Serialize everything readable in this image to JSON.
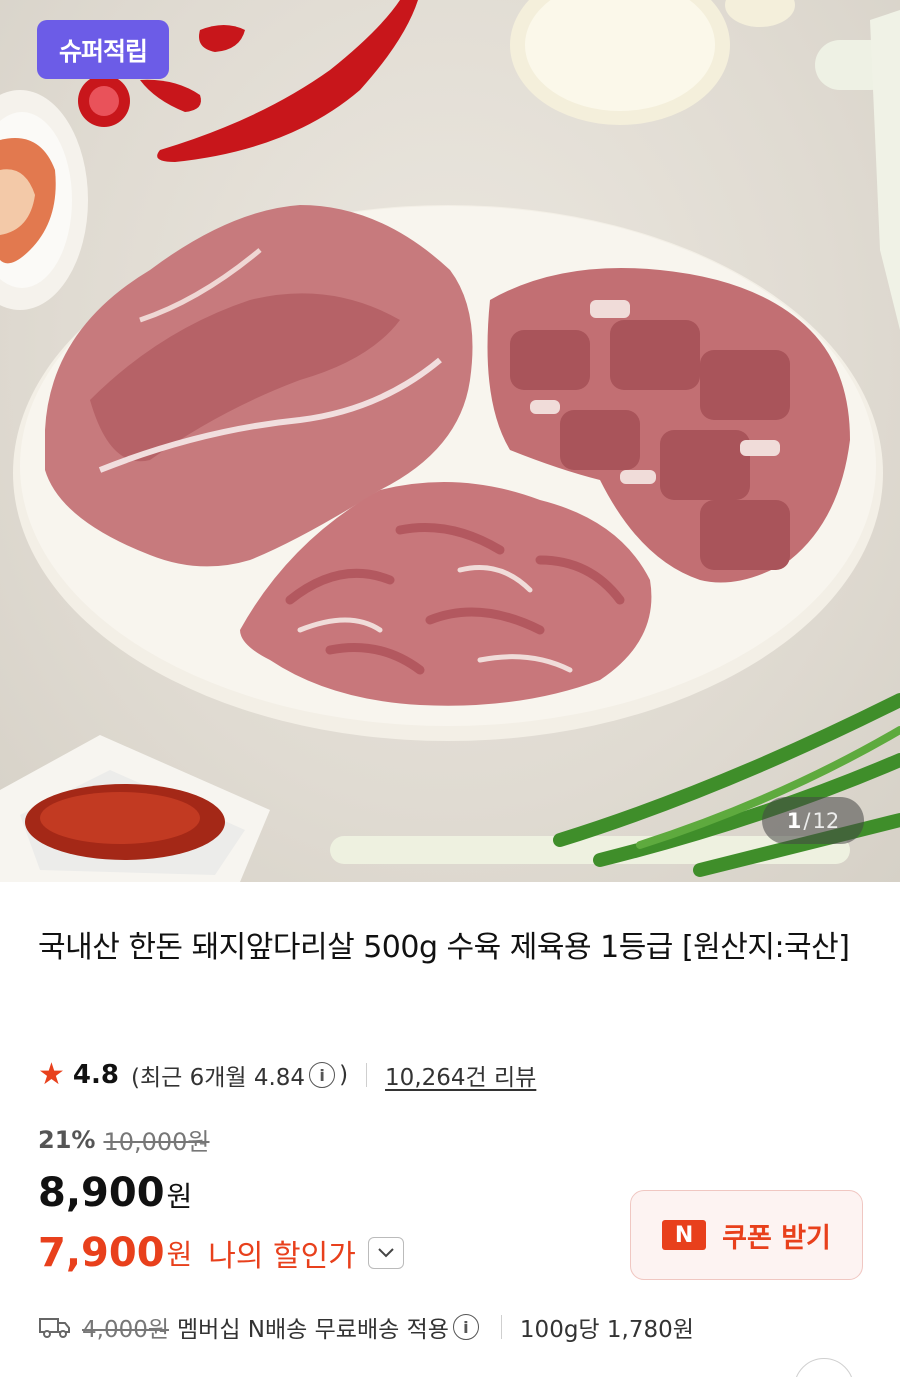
{
  "product_image": {
    "badge_label": "슈퍼적립",
    "counter_current": "1",
    "counter_separator": "/",
    "counter_total": "12"
  },
  "product": {
    "title": "국내산 한돈 돼지앞다리살 500g 수육 제육용 1등급 [원산지:국산]",
    "rating": "4.8",
    "recent_rating_prefix": "(최근 6개월 4.84",
    "recent_rating_suffix": ")",
    "review_count": "10,264건 리뷰",
    "discount_percent": "21%",
    "original_price": "10,000원",
    "price": "8,900",
    "price_unit": "원",
    "my_price": "7,900",
    "my_price_unit": "원",
    "my_price_label": "나의 할인가"
  },
  "coupon": {
    "icon_label": "N",
    "label": "쿠폰 받기"
  },
  "shipping": {
    "original_fee": "4,000원",
    "text": "멤버십 N배송 무료배송 적용",
    "unit_price": "100g당 1,780원"
  },
  "icons": {
    "star": "star-icon",
    "info": "info-icon",
    "chevron": "chevron-down-icon",
    "truck": "truck-icon"
  },
  "colors": {
    "accent": "#e8401c",
    "badge": "#6c5ce7"
  }
}
